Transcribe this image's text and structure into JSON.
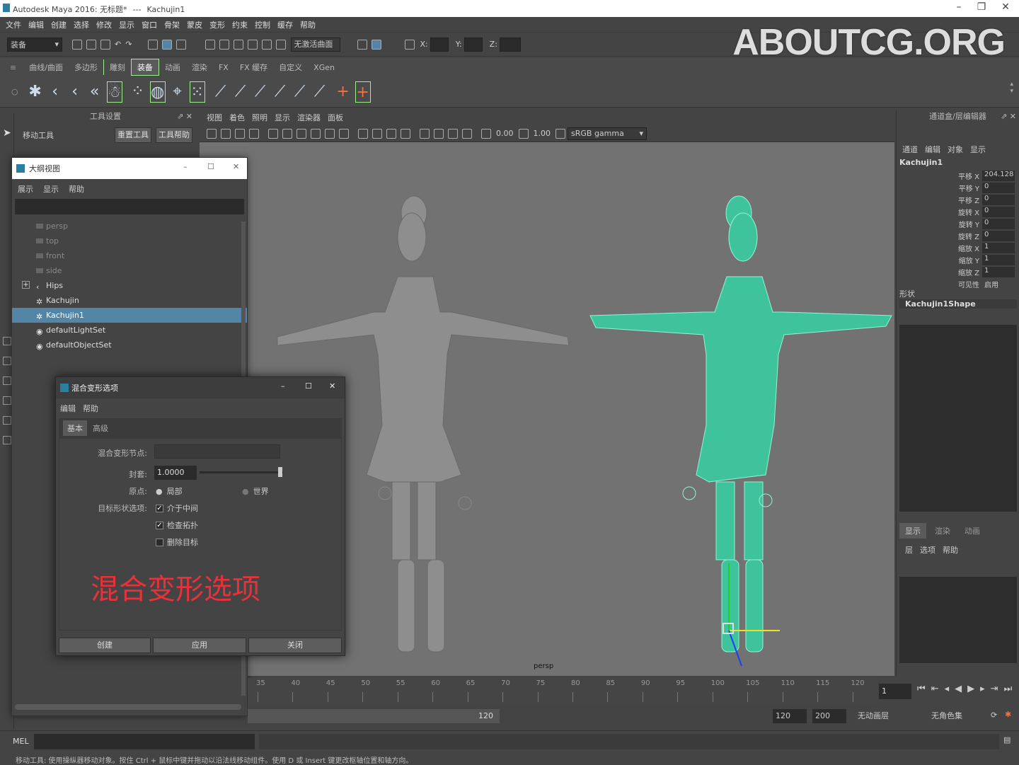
{
  "app": {
    "title": "Autodesk Maya 2016: 无标题*",
    "separator": "---",
    "selection": "Kachujin1"
  },
  "menu": [
    "文件",
    "编辑",
    "创建",
    "选择",
    "修改",
    "显示",
    "窗口",
    "骨架",
    "蒙皮",
    "变形",
    "约束",
    "控制",
    "缓存",
    "帮助"
  ],
  "status": {
    "mode": "装备",
    "no_live": "无激活曲面",
    "x_label": "X:",
    "y_label": "Y:",
    "z_label": "Z:"
  },
  "watermark": "ABOUTCG.ORG",
  "shelf_tabs": [
    "曲线/曲面",
    "多边形",
    "雕刻",
    "装备",
    "动画",
    "渲染",
    "FX",
    "FX 缓存",
    "自定义",
    "XGen"
  ],
  "shelf_active": "装备",
  "tool_settings": {
    "title": "工具设置",
    "tool_name": "移动工具",
    "reset_button": "重置工具",
    "help_button": "工具帮助"
  },
  "viewport": {
    "menu": [
      "视图",
      "着色",
      "照明",
      "显示",
      "渲染器",
      "面板"
    ],
    "exposure": "0.00",
    "gamma": "1.00",
    "color_space": "sRGB gamma",
    "camera_label": "persp"
  },
  "channel_box": {
    "title": "通道盒/层编辑器",
    "menu": [
      "通道",
      "编辑",
      "对象",
      "显示"
    ],
    "object": "Kachujin1",
    "attrs": [
      {
        "label": "平移 X",
        "value": "204.128"
      },
      {
        "label": "平移 Y",
        "value": "0"
      },
      {
        "label": "平移 Z",
        "value": "0"
      },
      {
        "label": "旋转 X",
        "value": "0"
      },
      {
        "label": "旋转 Y",
        "value": "0"
      },
      {
        "label": "旋转 Z",
        "value": "0"
      },
      {
        "label": "缩放 X",
        "value": "1"
      },
      {
        "label": "缩放 Y",
        "value": "1"
      },
      {
        "label": "缩放 Z",
        "value": "1"
      },
      {
        "label": "可见性",
        "value": "启用"
      }
    ],
    "shape_header": "形状",
    "shape_name": "Kachujin1Shape",
    "layer_tabs": [
      "显示",
      "渲染",
      "动画"
    ],
    "layer_menu": [
      "层",
      "选项",
      "帮助"
    ]
  },
  "outliner": {
    "title": "大纲视图",
    "menu": [
      "展示",
      "显示",
      "帮助"
    ],
    "items": [
      {
        "label": "persp",
        "icon": "camera-icon",
        "state": "dim"
      },
      {
        "label": "top",
        "icon": "camera-icon",
        "state": "dim"
      },
      {
        "label": "front",
        "icon": "camera-icon",
        "state": "dim"
      },
      {
        "label": "side",
        "icon": "camera-icon",
        "state": "dim"
      },
      {
        "label": "Hips",
        "icon": "joint-icon",
        "state": "normal"
      },
      {
        "label": "Kachujin",
        "icon": "mesh-icon",
        "state": "normal"
      },
      {
        "label": "Kachujin1",
        "icon": "mesh-icon",
        "state": "selected"
      },
      {
        "label": "defaultLightSet",
        "icon": "set-icon",
        "state": "normal"
      },
      {
        "label": "defaultObjectSet",
        "icon": "set-icon",
        "state": "normal"
      }
    ],
    "expand_glyph": "+"
  },
  "blend": {
    "title": "混合变形选项",
    "menu": [
      "编辑",
      "帮助"
    ],
    "tabs": [
      "基本",
      "高级"
    ],
    "node_label": "混合变形节点:",
    "node_value": "",
    "envelope_label": "封套:",
    "envelope_value": "1.0000",
    "envelope_level": 1.0,
    "origin_label": "原点:",
    "origin_local": "局部",
    "origin_world": "世界",
    "target_label": "目标形状选项:",
    "opt_inbetween": "介于中间",
    "opt_topology": "检查拓扑",
    "opt_delete": "删除目标",
    "overlay_caption": "混合变形选项",
    "create_button": "创建",
    "apply_button": "应用",
    "close_button": "关闭"
  },
  "time": {
    "ticks": [
      "35",
      "40",
      "45",
      "50",
      "55",
      "60",
      "65",
      "70",
      "75",
      "80",
      "85",
      "90",
      "95",
      "100",
      "105",
      "110",
      "115",
      "120"
    ],
    "current_frame": "1",
    "range_end": "120",
    "anim_end": "120",
    "anim_total": "200",
    "anim_layer": "无动画层",
    "char_set": "无角色集"
  },
  "cmd": {
    "label": "MEL",
    "help": "移动工具: 使用操纵器移动对象。按住 Ctrl + 鼠标中键并拖动以沿法线移动组件。使用 D 或 Insert 键更改枢轴位置和轴方向。"
  },
  "colors": {
    "accent_green": "#9cf08a",
    "wireframe": "#55e0b3",
    "selection": "#5285a6",
    "caption_red": "#e8313a"
  }
}
